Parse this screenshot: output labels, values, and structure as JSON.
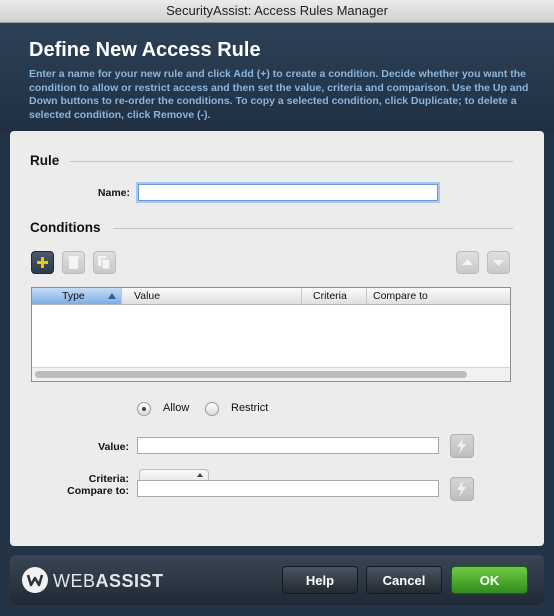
{
  "window": {
    "title": "SecurityAssist: Access Rules Manager"
  },
  "header": {
    "title": "Define New Access Rule",
    "description": "Enter a name for your new rule and click Add (+) to create a condition. Decide whether you want the condition to allow or restrict access and then set the value, criteria and comparison. Use the Up and Down buttons to re-order the conditions. To copy a selected condition, click Duplicate; to delete a selected condition, click Remove (-)."
  },
  "rule": {
    "section_title": "Rule",
    "name_label": "Name:",
    "name_value": ""
  },
  "conditions": {
    "section_title": "Conditions",
    "toolbar": {
      "add_icon": "plus-icon",
      "remove_icon": "trash-icon",
      "duplicate_icon": "copy-icon",
      "up_icon": "arrow-up-icon",
      "down_icon": "arrow-down-icon"
    },
    "columns": [
      "Type",
      "Value",
      "Criteria",
      "Compare to"
    ],
    "rows": []
  },
  "access": {
    "allow_label": "Allow",
    "restrict_label": "Restrict",
    "selected": "Allow"
  },
  "fields": {
    "value_label": "Value:",
    "value_value": "",
    "criteria_label": "Criteria:",
    "criteria_selected": "",
    "compare_label": "Compare to:",
    "compare_value": "",
    "server_behavior_icon": "lightning-bolt-icon"
  },
  "footer": {
    "logo_prefix": "WEB",
    "logo_suffix": "ASSIST",
    "help_label": "Help",
    "cancel_label": "Cancel",
    "ok_label": "OK"
  },
  "colors": {
    "ok_button": "#3f9f27",
    "header_text": "#8ab5dd",
    "focus_ring": "#a8c6ee"
  }
}
